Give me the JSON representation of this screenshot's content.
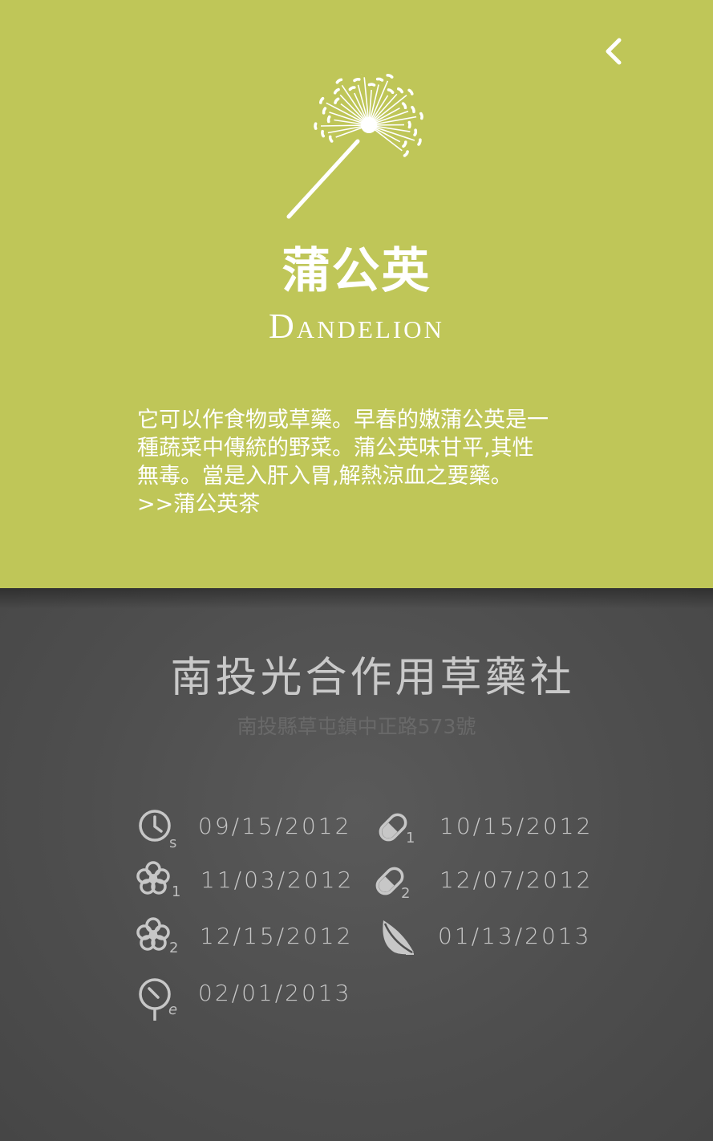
{
  "header": {
    "back_icon": "chevron-left-icon",
    "logo_icon": "dandelion-icon"
  },
  "plant": {
    "name_zh": "蒲公英",
    "name_en": "Dandelion",
    "desc_lines": [
      "它可以作食物或草藥。早春的嫩蒲公英是一",
      "種蔬菜中傳統的野菜。蒲公英味甘平,其性",
      "無毒。當是入肝入胃,解熱涼血之要藥。"
    ],
    "link": ">>蒲公英茶"
  },
  "shop": {
    "name": "南投光合作用草藥社",
    "address": "南投縣草屯鎮中正路573號"
  },
  "dates": [
    {
      "icon": "clock-icon",
      "sub": "s",
      "date": "09/15/2012"
    },
    {
      "icon": "pill-icon",
      "sub": "1",
      "date": "10/15/2012"
    },
    {
      "icon": "flower-icon",
      "sub": "1",
      "date": "11/03/2012"
    },
    {
      "icon": "pill-icon",
      "sub": "2",
      "date": "12/07/2012"
    },
    {
      "icon": "flower-icon",
      "sub": "2",
      "date": "12/15/2012"
    },
    {
      "icon": "leaf-icon",
      "sub": "",
      "date": "01/13/2013"
    },
    {
      "icon": "clock-icon",
      "sub": "e",
      "date": "02/01/2013"
    }
  ],
  "colors": {
    "accent": "#bfc658",
    "background": "#4f4f4f",
    "text_light": "#ffffff",
    "text_muted": "#c7c7c7"
  }
}
